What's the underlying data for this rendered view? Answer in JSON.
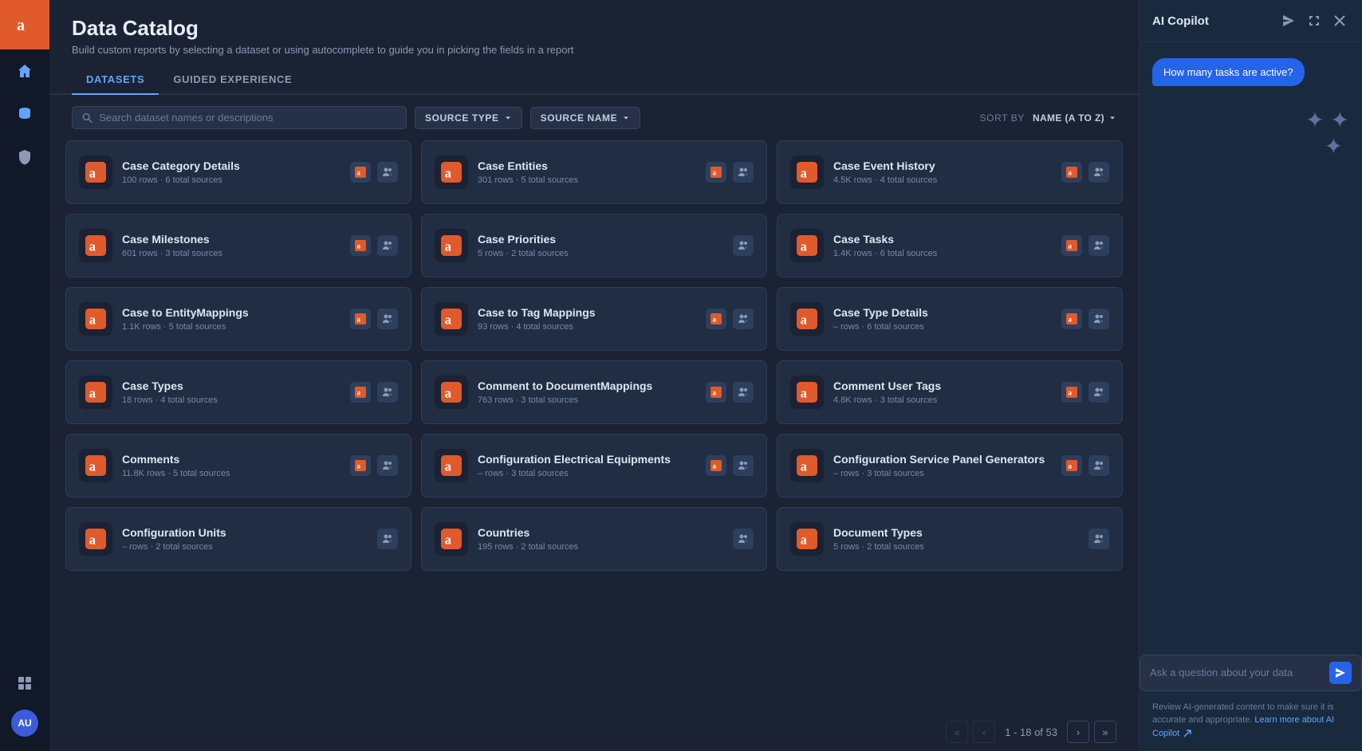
{
  "app": {
    "logo": "a",
    "title": "Data Catalog",
    "subtitle": "Build custom reports by selecting a dataset or using autocomplete to guide you in picking the fields in a report"
  },
  "tabs": [
    {
      "id": "datasets",
      "label": "DATASETS",
      "active": true
    },
    {
      "id": "guided",
      "label": "GUIDED EXPERIENCE",
      "active": false
    }
  ],
  "toolbar": {
    "search_placeholder": "Search dataset names or descriptions",
    "source_type_label": "SOURCE TYPE",
    "source_name_label": "SOURCE NAME",
    "sort_by_label": "SORT BY",
    "sort_value": "NAME (A TO Z)"
  },
  "cards": [
    {
      "id": "case-category-details",
      "title": "Case Category Details",
      "rows": "100",
      "row_label": "rows",
      "sources": "6",
      "sources_label": "total sources",
      "has_user_icon": true,
      "has_appian_icon": true
    },
    {
      "id": "case-entities",
      "title": "Case Entities",
      "rows": "301",
      "row_label": "rows",
      "sources": "5",
      "sources_label": "total sources",
      "has_user_icon": true,
      "has_appian_icon": true
    },
    {
      "id": "case-event-history",
      "title": "Case Event History",
      "rows": "4.5K",
      "row_label": "rows",
      "sources": "4",
      "sources_label": "total sources",
      "has_user_icon": true,
      "has_appian_icon": true
    },
    {
      "id": "case-milestones",
      "title": "Case Milestones",
      "rows": "601",
      "row_label": "rows",
      "sources": "3",
      "sources_label": "total sources",
      "has_user_icon": true,
      "has_appian_icon": true
    },
    {
      "id": "case-priorities",
      "title": "Case Priorities",
      "rows": "5",
      "row_label": "rows",
      "sources": "2",
      "sources_label": "total sources",
      "has_user_icon": true,
      "has_appian_icon": false
    },
    {
      "id": "case-tasks",
      "title": "Case Tasks",
      "rows": "1.4K",
      "row_label": "rows",
      "sources": "6",
      "sources_label": "total sources",
      "has_user_icon": true,
      "has_appian_icon": true
    },
    {
      "id": "case-to-entitymappings",
      "title": "Case to EntityMappings",
      "rows": "1.1K",
      "row_label": "rows",
      "sources": "5",
      "sources_label": "total sources",
      "has_user_icon": true,
      "has_appian_icon": true
    },
    {
      "id": "case-to-tag-mappings",
      "title": "Case to Tag Mappings",
      "rows": "93",
      "row_label": "rows",
      "sources": "4",
      "sources_label": "total sources",
      "has_user_icon": true,
      "has_appian_icon": true
    },
    {
      "id": "case-type-details",
      "title": "Case Type Details",
      "rows": "–",
      "row_label": "rows",
      "sources": "6",
      "sources_label": "total sources",
      "has_user_icon": true,
      "has_appian_icon": true
    },
    {
      "id": "case-types",
      "title": "Case Types",
      "rows": "18",
      "row_label": "rows",
      "sources": "4",
      "sources_label": "total sources",
      "has_user_icon": true,
      "has_appian_icon": true
    },
    {
      "id": "comment-to-documentmappings",
      "title": "Comment to DocumentMappings",
      "rows": "763",
      "row_label": "rows",
      "sources": "3",
      "sources_label": "total sources",
      "has_user_icon": true,
      "has_appian_icon": true
    },
    {
      "id": "comment-user-tags",
      "title": "Comment User Tags",
      "rows": "4.8K",
      "row_label": "rows",
      "sources": "3",
      "sources_label": "total sources",
      "has_user_icon": true,
      "has_appian_icon": true
    },
    {
      "id": "comments",
      "title": "Comments",
      "rows": "11.8K",
      "row_label": "rows",
      "sources": "5",
      "sources_label": "total sources",
      "has_user_icon": true,
      "has_appian_icon": true
    },
    {
      "id": "configuration-electrical-equipments",
      "title": "Configuration Electrical Equipments",
      "rows": "–",
      "row_label": "rows",
      "sources": "3",
      "sources_label": "total sources",
      "has_user_icon": true,
      "has_appian_icon": true
    },
    {
      "id": "configuration-service-panel-generators",
      "title": "Configuration Service Panel Generators",
      "rows": "–",
      "row_label": "rows",
      "sources": "3",
      "sources_label": "total sources",
      "has_user_icon": true,
      "has_appian_icon": true
    },
    {
      "id": "configuration-units",
      "title": "Configuration Units",
      "rows": "–",
      "row_label": "rows",
      "sources": "2",
      "sources_label": "total sources",
      "has_user_icon": true,
      "has_appian_icon": false
    },
    {
      "id": "countries",
      "title": "Countries",
      "rows": "195",
      "row_label": "rows",
      "sources": "2",
      "sources_label": "total sources",
      "has_user_icon": true,
      "has_appian_icon": false
    },
    {
      "id": "document-types",
      "title": "Document Types",
      "rows": "5",
      "row_label": "rows",
      "sources": "2",
      "sources_label": "total sources",
      "has_user_icon": true,
      "has_appian_icon": false
    }
  ],
  "pagination": {
    "current_start": "1",
    "current_end": "18",
    "total": "53"
  },
  "copilot": {
    "title": "AI Copilot",
    "message": "How many tasks are active?",
    "input_placeholder": "Ask a question about your data",
    "footer": "Review AI-generated content to make sure it is accurate and appropriate.",
    "footer_link": "Learn more about AI Copilot"
  },
  "sidebar": {
    "nav_items": [
      {
        "id": "home",
        "icon": "⌂"
      },
      {
        "id": "database",
        "icon": "🗄"
      },
      {
        "id": "shield",
        "icon": "🛡"
      }
    ],
    "bottom_items": [
      {
        "id": "grid",
        "icon": "⊞"
      }
    ],
    "avatar": "AU"
  }
}
